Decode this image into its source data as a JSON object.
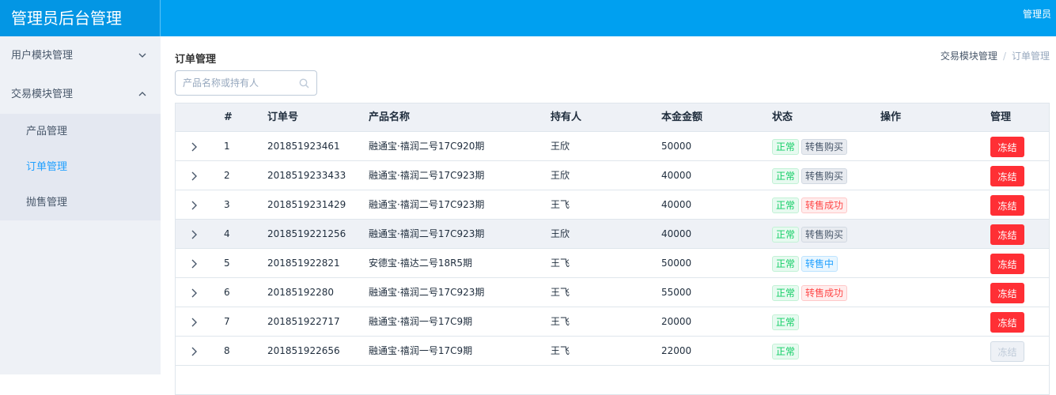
{
  "header": {
    "brand": "管理员后台管理",
    "user": "管理员"
  },
  "sidebar": {
    "groups": [
      {
        "label": "用户模块管理",
        "expanded": false
      },
      {
        "label": "交易模块管理",
        "expanded": true,
        "items": [
          "产品管理",
          "订单管理",
          "抛售管理"
        ],
        "active": "订单管理"
      }
    ]
  },
  "main": {
    "title": "订单管理",
    "breadcrumb": [
      "交易模块管理",
      "订单管理"
    ],
    "search_placeholder": "产品名称或持有人",
    "columns": [
      "#",
      "订单号",
      "产品名称",
      "持有人",
      "本金金额",
      "状态",
      "操作",
      "管理"
    ],
    "rows": [
      {
        "idx": "1",
        "no": "201851923461",
        "name": "融通宝·禧润二号17C920期",
        "owner": "王欣",
        "amount": "50000",
        "status": "正常",
        "trade": "转售购买",
        "trade_type": "gray",
        "action": "冻结",
        "disabled": false
      },
      {
        "idx": "2",
        "no": "2018519233433",
        "name": "融通宝·禧润二号17C923期",
        "owner": "王欣",
        "amount": "40000",
        "status": "正常",
        "trade": "转售购买",
        "trade_type": "gray",
        "action": "冻结",
        "disabled": false
      },
      {
        "idx": "3",
        "no": "2018519231429",
        "name": "融通宝·禧润二号17C923期",
        "owner": "王飞",
        "amount": "40000",
        "status": "正常",
        "trade": "转售成功",
        "trade_type": "red",
        "action": "冻结",
        "disabled": false
      },
      {
        "idx": "4",
        "no": "2018519221256",
        "name": "融通宝·禧润二号17C923期",
        "owner": "王欣",
        "amount": "40000",
        "status": "正常",
        "trade": "转售购买",
        "trade_type": "gray",
        "action": "冻结",
        "disabled": false
      },
      {
        "idx": "5",
        "no": "201851922821",
        "name": "安德宝·禧达二号18R5期",
        "owner": "王飞",
        "amount": "50000",
        "status": "正常",
        "trade": "转售中",
        "trade_type": "blue",
        "action": "冻结",
        "disabled": false
      },
      {
        "idx": "6",
        "no": "20185192280",
        "name": "融通宝·禧润二号17C923期",
        "owner": "王飞",
        "amount": "55000",
        "status": "正常",
        "trade": "转售成功",
        "trade_type": "red",
        "action": "冻结",
        "disabled": false
      },
      {
        "idx": "7",
        "no": "201851922717",
        "name": "融通宝·禧润一号17C9期",
        "owner": "王飞",
        "amount": "20000",
        "status": "正常",
        "trade": "",
        "trade_type": "",
        "action": "冻结",
        "disabled": false
      },
      {
        "idx": "8",
        "no": "201851922656",
        "name": "融通宝·禧润一号17C9期",
        "owner": "王飞",
        "amount": "22000",
        "status": "正常",
        "trade": "",
        "trade_type": "",
        "action": "冻结",
        "disabled": true
      }
    ]
  },
  "colors": {
    "header": "#00a0f0",
    "brand": "#0396e4",
    "accent": "#20a0ff",
    "danger": "#ff2f35",
    "success": "#13ce66"
  },
  "icons": {
    "expand": "chevron-right-icon",
    "search": "search-icon",
    "collapse": "chevron-down-icon",
    "expanded": "chevron-up-icon"
  }
}
